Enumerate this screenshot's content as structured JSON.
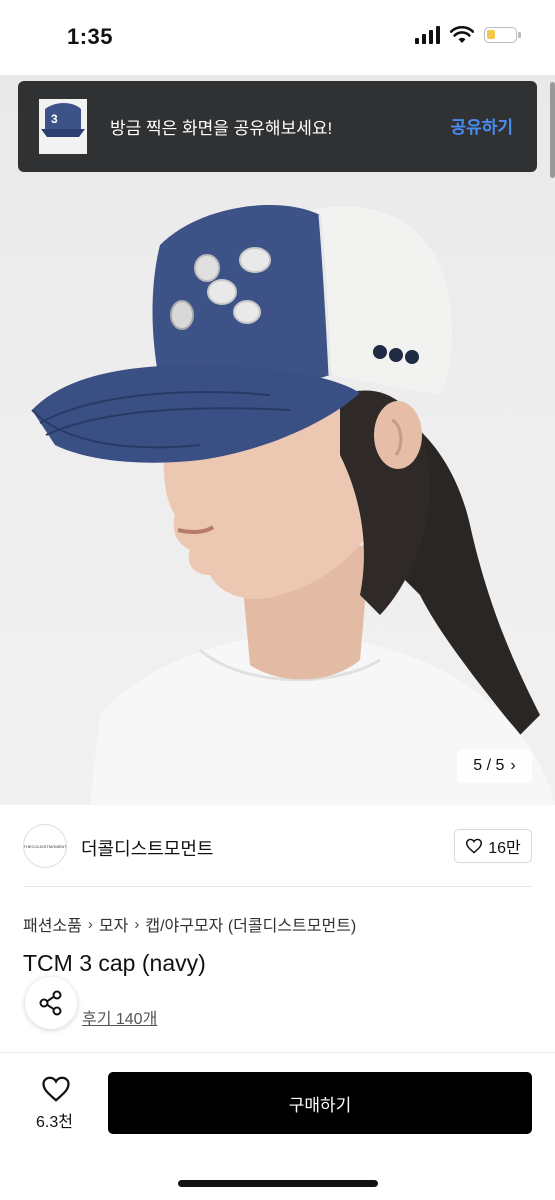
{
  "status_bar": {
    "time": "1:35"
  },
  "share_banner": {
    "message": "방금 찍은 화면을 공유해보세요!",
    "action_label": "공유하기"
  },
  "gallery": {
    "counter": "5 / 5"
  },
  "seller": {
    "logo_text": "THECOLDISTMOMENT",
    "name": "더콜디스트모먼트",
    "likes": "16만"
  },
  "breadcrumb": [
    "패션소품",
    "모자",
    "캡/야구모자 (더콜디스트모먼트)"
  ],
  "product": {
    "title": "TCM 3 cap (navy)",
    "reviews": "후기 140개"
  },
  "bottom_bar": {
    "wish_count": "6.3천",
    "buy_label": "구매하기"
  },
  "colors": {
    "share_banner_bg": "#2f3133",
    "share_action": "#4a8df0",
    "buy_button_bg": "#000000",
    "cap_navy": "#3d5388"
  }
}
